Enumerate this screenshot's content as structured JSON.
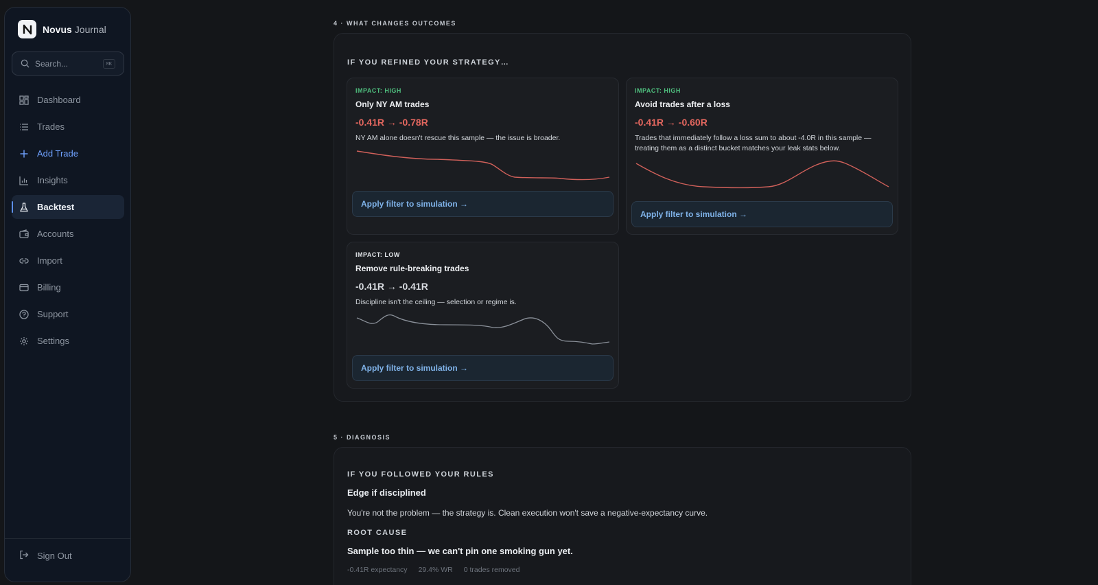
{
  "brand": {
    "logo_letter": "N",
    "name": "Novus",
    "sub": "Journal"
  },
  "search": {
    "placeholder": "Search...",
    "shortcut": "⌘K"
  },
  "sidebar": {
    "items": [
      {
        "label": "Dashboard",
        "icon": "dashboard-icon"
      },
      {
        "label": "Trades",
        "icon": "list-icon"
      },
      {
        "label": "Add Trade",
        "icon": "plus-icon"
      },
      {
        "label": "Insights",
        "icon": "bar-chart-icon"
      },
      {
        "label": "Backtest",
        "icon": "flask-icon"
      },
      {
        "label": "Accounts",
        "icon": "wallet-icon"
      },
      {
        "label": "Import",
        "icon": "link-icon"
      },
      {
        "label": "Billing",
        "icon": "card-icon"
      },
      {
        "label": "Support",
        "icon": "help-icon"
      },
      {
        "label": "Settings",
        "icon": "gear-icon"
      }
    ],
    "active": "Backtest",
    "signout": "Sign Out"
  },
  "outcomes": {
    "section_label": "4 · WHAT CHANGES OUTCOMES",
    "heading": "IF YOU REFINED YOUR STRATEGY…",
    "cards": [
      {
        "impact": "IMPACT: HIGH",
        "title": "Only NY AM trades",
        "metric": "-0.41R → -0.78R",
        "desc": "NY AM alone doesn't rescue this sample — the issue is broader.",
        "button": "Apply filter to simulation →"
      },
      {
        "impact": "IMPACT: HIGH",
        "title": "Avoid trades after a loss",
        "metric": "-0.41R → -0.60R",
        "desc": "Trades that immediately follow a loss sum to about -4.0R in this sample — treating them as a distinct bucket matches your leak stats below.",
        "button": "Apply filter to simulation →"
      },
      {
        "impact": "IMPACT: LOW",
        "title": "Remove rule-breaking trades",
        "metric": "-0.41R → -0.41R",
        "desc": "Discipline isn't the ceiling — selection or regime is.",
        "button": "Apply filter to simulation →"
      }
    ]
  },
  "diagnosis": {
    "section_label": "5 · DIAGNOSIS",
    "heading": "IF YOU FOLLOWED YOUR RULES",
    "title": "Edge if disciplined",
    "text": "You're not the problem — the strategy is. Clean execution won't save a negative-expectancy curve.",
    "root_label": "ROOT CAUSE",
    "root_text": "Sample too thin — we can't pin one smoking gun yet.",
    "stats": [
      "-0.41R expectancy",
      "29.4% WR",
      "0 trades removed"
    ]
  },
  "colors": {
    "accent": "#6fa1ff",
    "impact_high": "#4fbf7e",
    "negative": "#e4675f",
    "button_text": "#7fb2e8"
  }
}
